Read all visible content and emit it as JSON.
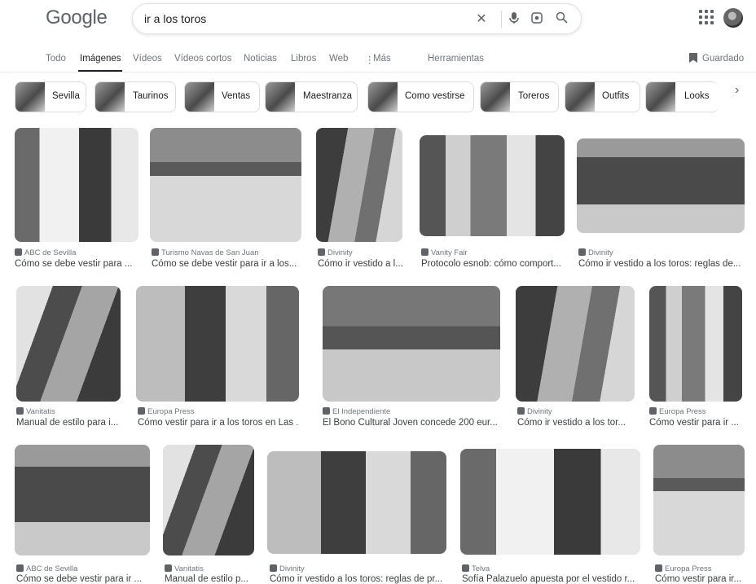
{
  "header": {
    "logo": "Google",
    "search_value": "ir a los toros"
  },
  "tabs": [
    {
      "label": "Todo"
    },
    {
      "label": "Imágenes"
    },
    {
      "label": "Vídeos"
    },
    {
      "label": "Vídeos cortos"
    },
    {
      "label": "Noticias"
    },
    {
      "label": "Libros"
    },
    {
      "label": "Web"
    },
    {
      "label": "Más"
    },
    {
      "label": "Herramientas"
    }
  ],
  "guardado": "Guardado",
  "chips": [
    {
      "label": "Sevilla"
    },
    {
      "label": "Taurinos"
    },
    {
      "label": "Ventas"
    },
    {
      "label": "Maestranza"
    },
    {
      "label": "Como vestirse"
    },
    {
      "label": "Toreros"
    },
    {
      "label": "Outfits"
    },
    {
      "label": "Looks"
    }
  ],
  "results": [
    {
      "source": "ABC de Sevilla",
      "title": "Cómo se debe vestir para ..."
    },
    {
      "source": "Turismo Navas de San Juan",
      "title": "Cómo se debe vestir para ir a los..."
    },
    {
      "source": "Divinity",
      "title": "Cómo ir vestido a l..."
    },
    {
      "source": "Vanity Fair",
      "title": "Protocolo esnob: cómo comport..."
    },
    {
      "source": "Divinity",
      "title": "Cómo ir vestido a los toros: reglas de..."
    },
    {
      "source": "Vanitatis",
      "title": "Manual de estilo para i..."
    },
    {
      "source": "Europa Press",
      "title": "Cómo vestir para ir a los toros en Las ..."
    },
    {
      "source": "El Independiente",
      "title": "El Bono Cultural Joven concede 200 eur..."
    },
    {
      "source": "Divinity",
      "title": "Cómo ir vestido a los tor..."
    },
    {
      "source": "Europa Press",
      "title": "Cómo vestir para ir ..."
    },
    {
      "source": "ABC de Sevilla",
      "title": "Cómo se debe vestir para ir ..."
    },
    {
      "source": "Vanitatis",
      "title": "Manual de estilo p..."
    },
    {
      "source": "Divinity",
      "title": "Cómo ir vestido a los toros: reglas de pr..."
    },
    {
      "source": "Telva",
      "title": "Sofía Palazuelo apuesta por el vestido r..."
    },
    {
      "source": "Europa Press",
      "title": "Cómo vestir para ir..."
    }
  ]
}
